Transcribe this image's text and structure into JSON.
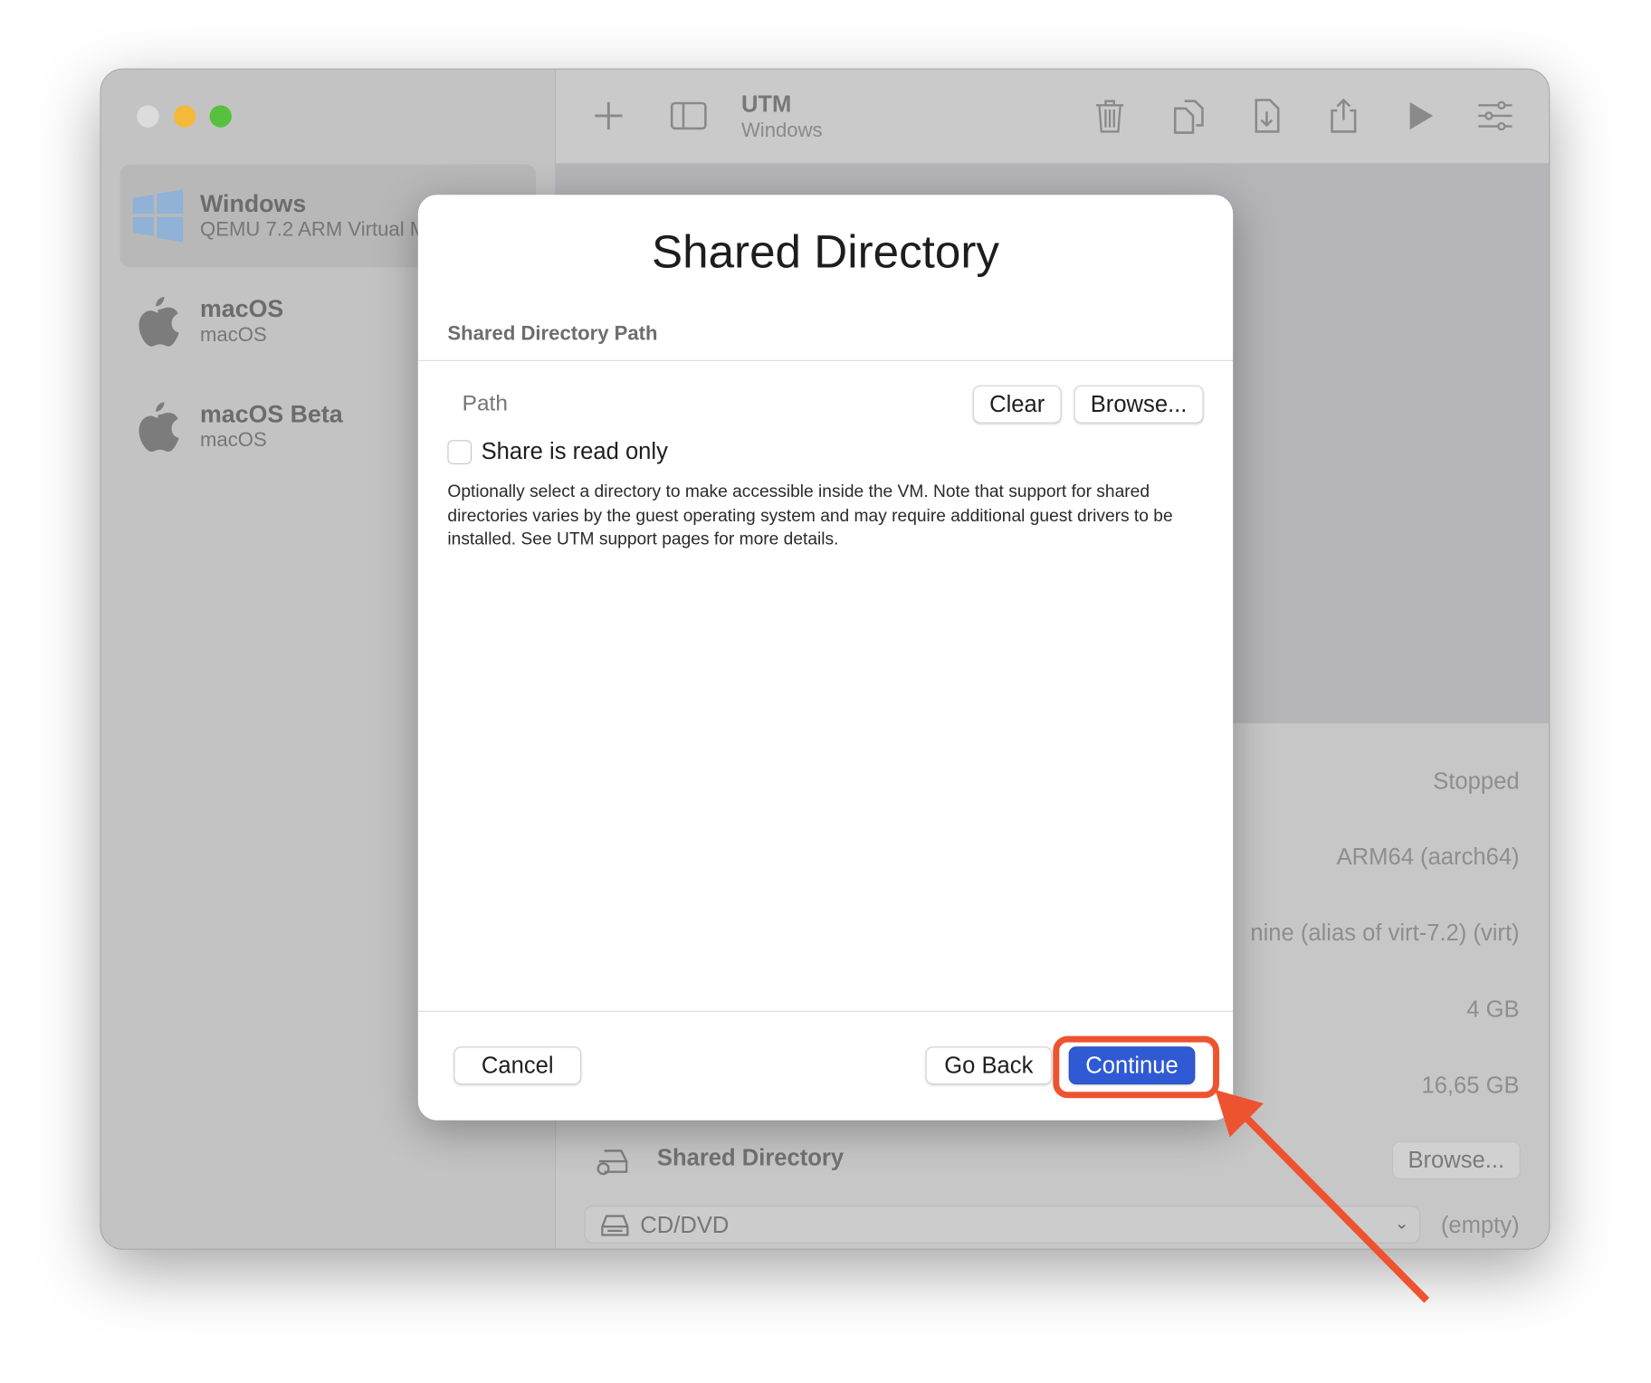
{
  "window": {
    "traffic_lights": {
      "close": "#dcdcdc",
      "minimize": "#f5b93a",
      "zoom": "#57c13f"
    }
  },
  "sidebar": {
    "items": [
      {
        "name": "Windows",
        "subtitle": "QEMU 7.2 ARM Virtual Machine",
        "icon": "windows-logo",
        "selected": true
      },
      {
        "name": "macOS",
        "subtitle": "macOS",
        "icon": "apple-logo"
      },
      {
        "name": "macOS Beta",
        "subtitle": "macOS",
        "icon": "apple-logo"
      }
    ]
  },
  "toolbar": {
    "title": "UTM",
    "subtitle": "Windows",
    "icons": [
      "plus-icon",
      "sidebar-icon",
      "trash-icon",
      "clone-icon",
      "download-icon",
      "share-icon",
      "play-icon",
      "sliders-icon"
    ]
  },
  "details": {
    "status": "Stopped",
    "architecture": "ARM64 (aarch64)",
    "machine": "nine (alias of virt-7.2) (virt)",
    "memory": "4 GB",
    "size": "16,65 GB",
    "shared_directory_label": "Shared Directory",
    "browse": "Browse...",
    "cd_label": "CD/DVD",
    "cd_value": "(empty)"
  },
  "dialog": {
    "title": "Shared Directory",
    "section": "Shared Directory Path",
    "path_placeholder": "Path",
    "path_value": "",
    "clear": "Clear",
    "browse": "Browse...",
    "read_only_label": "Share is read only",
    "read_only_checked": false,
    "description": "Optionally select a directory to make accessible inside the VM. Note that support for shared directories varies by the guest operating system and may require additional guest drivers to be installed. See UTM support pages for more details.",
    "cancel": "Cancel",
    "go_back": "Go Back",
    "continue": "Continue"
  },
  "annotation": {
    "color": "#ee5330",
    "target": "Continue"
  },
  "colors": {
    "accent": "#2f5ad3"
  }
}
